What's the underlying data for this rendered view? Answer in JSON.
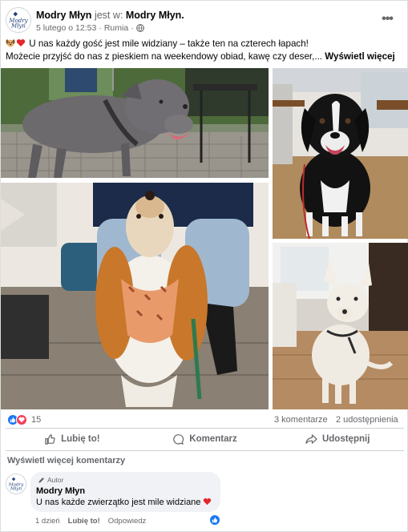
{
  "post": {
    "page_name": "Modry Młyn",
    "checkin_prefix": "jest w:",
    "checkin_place": "Modry Młyn.",
    "date": "5 lutego o 12:53",
    "location": "Rumia",
    "text_line1": "U nas każdy gość jest mile widziany – także ten na czterech łapach!",
    "text_line2": "Możecie przyjść do nas z pieskiem na weekendowy obiad, kawę czy deser,...",
    "see_more": "Wyświetl więcej",
    "more_icon": "more-options-icon",
    "avatar_text": [
      "Modry",
      "Młyn"
    ]
  },
  "photos": [
    {
      "alt_name": "grey-pitbull-photo"
    },
    {
      "alt_name": "black-white-dog-photo"
    },
    {
      "alt_name": "spaniel-dog-photo"
    },
    {
      "alt_name": "white-small-dog-photo"
    }
  ],
  "reactions": {
    "count": "15",
    "comments": "3 komentarze",
    "shares": "2 udostępnienia",
    "colors": {
      "like": "#1877f2",
      "love": "#f33e58"
    }
  },
  "actions": {
    "like": "Lubię to!",
    "comment": "Komentarz",
    "share": "Udostępnij"
  },
  "comments_section": {
    "view_more": "Wyświetl więcej komentarzy",
    "comment": {
      "badge": "Autor",
      "author": "Modry Młyn",
      "text": "U nas każde zwierzątko jest mile widziane",
      "time": "1 dzień",
      "like": "Lubię to!",
      "reply": "Odpowiedz"
    }
  }
}
